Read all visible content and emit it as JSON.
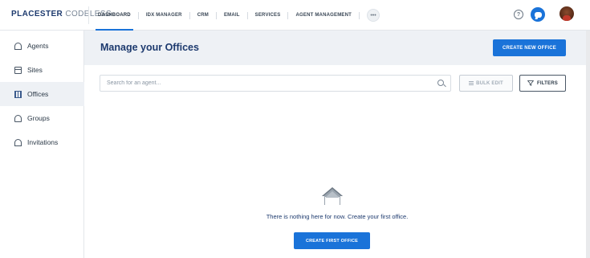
{
  "brand": {
    "part1": "PLACESTER",
    "part2": " CODELESS"
  },
  "nav": {
    "items": [
      {
        "label": "DASHBOARD",
        "active": true
      },
      {
        "label": "IDX MANAGER",
        "active": false
      },
      {
        "label": "CRM",
        "active": false
      },
      {
        "label": "EMAIL",
        "active": false
      },
      {
        "label": "SERVICES",
        "active": false
      },
      {
        "label": "AGENT MANAGEMENT",
        "active": false
      }
    ],
    "more_label": "•••"
  },
  "top_right": {
    "help_icon": "?",
    "chat_icon": "chat-icon",
    "avatar": "user-avatar"
  },
  "sidebar": {
    "items": [
      {
        "label": "Agents",
        "icon": "person-icon",
        "active": false
      },
      {
        "label": "Sites",
        "icon": "browser-icon",
        "active": false
      },
      {
        "label": "Offices",
        "icon": "building-icon",
        "active": true
      },
      {
        "label": "Groups",
        "icon": "group-icon",
        "active": false
      },
      {
        "label": "Invitations",
        "icon": "add-person-icon",
        "active": false
      }
    ]
  },
  "header": {
    "title": "Manage your Offices",
    "create_button": "CREATE NEW OFFICE"
  },
  "toolbar": {
    "search_placeholder": "Search for an agent...",
    "bulk_edit_label": "BULK EDIT",
    "filters_label": "FILTERS"
  },
  "empty_state": {
    "icon": "house-icon",
    "message": "There is nothing here for now. Create your first office.",
    "button_label": "CREATE FIRST OFFICE"
  },
  "colors": {
    "accent": "#1a73d9",
    "title": "#1d3a6e",
    "header_band": "#eef1f5"
  }
}
